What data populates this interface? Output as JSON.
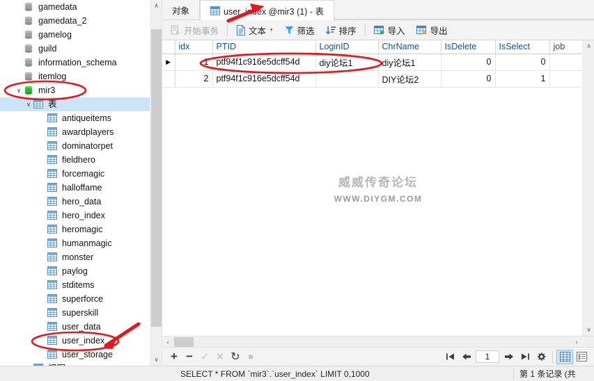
{
  "sidebar": {
    "databases": [
      {
        "label": "gamedata",
        "icon": "database-icon",
        "state": "collapsed"
      },
      {
        "label": "gamedata_2",
        "icon": "database-icon",
        "state": "collapsed"
      },
      {
        "label": "gamelog",
        "icon": "database-icon",
        "state": "collapsed"
      },
      {
        "label": "guild",
        "icon": "database-icon",
        "state": "collapsed"
      },
      {
        "label": "information_schema",
        "icon": "database-icon",
        "state": "collapsed"
      },
      {
        "label": "itemlog",
        "icon": "database-icon",
        "state": "collapsed"
      }
    ],
    "active_database": {
      "label": "mir3",
      "icon": "database-icon-active",
      "twisty": "∨"
    },
    "tables_node": {
      "label": "表",
      "icon": "table-group-icon",
      "twisty": "∨"
    },
    "tables": [
      "antiqueitems",
      "awardplayers",
      "dominatorpet",
      "fieldhero",
      "forcemagic",
      "halloffame",
      "hero_data",
      "hero_index",
      "heromagic",
      "humanmagic",
      "monster",
      "paylog",
      "stditems",
      "superforce",
      "superskill",
      "user_data",
      "user_index",
      "user_storage"
    ],
    "views_node": {
      "label": "视图",
      "icon": "view-group-icon"
    },
    "scroll_up_arrow": "∧",
    "scroll_down_arrow": "∨"
  },
  "tabs": {
    "object_tab": {
      "label": "对象",
      "active": false
    },
    "table_tab": {
      "label": "user_index @mir3 (1) - 表",
      "icon": "table-icon",
      "active": true
    }
  },
  "toolbar": {
    "begin_transaction": {
      "label": "开始事务",
      "icon": "transaction-icon",
      "disabled": true
    },
    "text": {
      "label": "文本",
      "icon": "text-icon",
      "caret": "▾"
    },
    "filter": {
      "label": "筛选",
      "icon": "filter-icon"
    },
    "sort": {
      "label": "排序",
      "icon": "sort-icon"
    },
    "import": {
      "label": "导入",
      "icon": "import-icon"
    },
    "export": {
      "label": "导出",
      "icon": "export-icon"
    }
  },
  "grid": {
    "columns": [
      "idx",
      "PTID",
      "LoginID",
      "ChrName",
      "IsDelete",
      "IsSelect",
      "job"
    ],
    "rows": [
      {
        "indicator": "▶",
        "selected": true,
        "cells": [
          "1",
          "ptf94f1c916e5dcff54d",
          "diy论坛1",
          "diy论坛1",
          "0",
          "0",
          ""
        ]
      },
      {
        "indicator": "",
        "selected": false,
        "cells": [
          "2",
          "ptf94f1c916e5dcff54d",
          "",
          "DIY论坛2",
          "0",
          "1",
          ""
        ]
      }
    ]
  },
  "watermark": {
    "line1": "威威传奇论坛",
    "line2": "WWW.DIYGM.COM"
  },
  "actions": {
    "add": {
      "icon": "plus-icon",
      "label": "+",
      "disabled": false
    },
    "remove": {
      "icon": "minus-icon",
      "label": "−",
      "disabled": false
    },
    "confirm": {
      "icon": "check-icon",
      "label": "✓",
      "disabled": true
    },
    "cancel": {
      "icon": "x-icon",
      "label": "✕",
      "disabled": true
    },
    "refresh": {
      "icon": "refresh-icon",
      "label": "↻",
      "disabled": false
    },
    "stop": {
      "icon": "stop-icon",
      "label": "■",
      "disabled": true
    }
  },
  "navigation": {
    "first": {
      "icon": "first-page-icon",
      "label": "❙←"
    },
    "prev": {
      "icon": "prev-page-icon",
      "label": "←"
    },
    "page_value": "1",
    "next": {
      "icon": "next-page-icon",
      "label": "→"
    },
    "last": {
      "icon": "last-page-icon",
      "label": "→❙"
    },
    "settings": {
      "icon": "gear-icon",
      "label": "⚙"
    },
    "grid_view": {
      "icon": "grid-view-icon",
      "active": true
    },
    "form_view": {
      "icon": "form-view-icon",
      "active": false
    }
  },
  "statusbar": {
    "query": "SELECT * FROM `mir3`.`user_index` LIMIT 0,1000",
    "record_info": "第 1 条记录 (共"
  },
  "scrollbars": {
    "left_arrow": "‹",
    "right_arrow": "›",
    "up_arrow": "∧",
    "down_arrow": "∨"
  },
  "colors": {
    "accent_blue": "#14538a",
    "selection_blue": "#cce4f7",
    "annotation_red": "#e01b1b",
    "db_icon_gray": "#9a9a9a",
    "db_icon_green": "#2eae34",
    "table_icon_blue": "#4f93cd"
  }
}
